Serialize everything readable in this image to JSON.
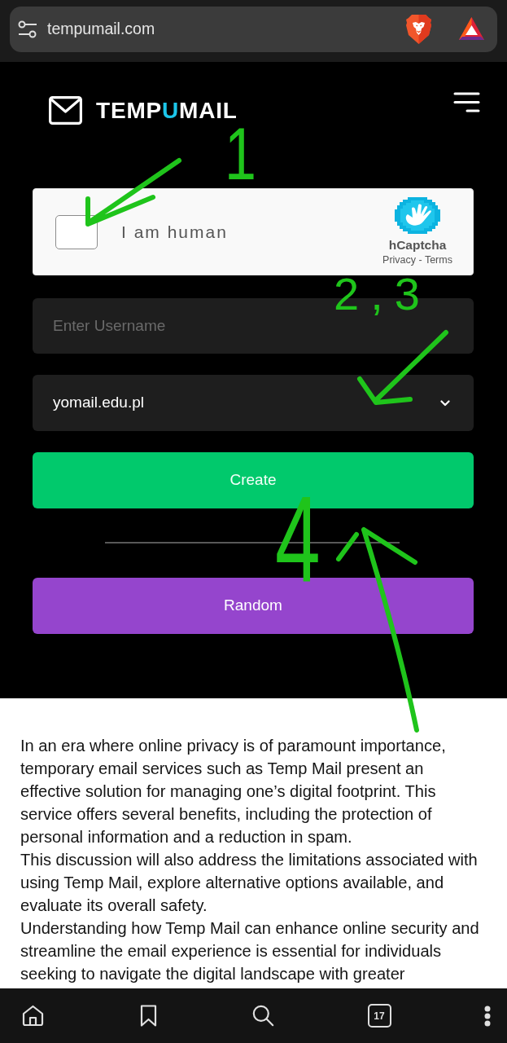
{
  "browser": {
    "url": "tempumail.com",
    "tab_count": "17"
  },
  "header": {
    "logo": [
      {
        "text": "TEMP",
        "accent": false
      },
      {
        "text": "U",
        "accent": true
      },
      {
        "text": "MAIL",
        "accent": false
      }
    ]
  },
  "captcha": {
    "checked": false,
    "label": "I am human",
    "brand": "hCaptcha",
    "links": "Privacy - Terms"
  },
  "form": {
    "username": {
      "placeholder": "Enter Username"
    },
    "domain": {
      "value": "yomail.edu.pl"
    },
    "buttons": [
      {
        "label": "Create",
        "kind": "primary"
      },
      {
        "label": "Random",
        "kind": "secondary"
      }
    ]
  },
  "article": {
    "paragraphs": [
      "In an era where online privacy is of paramount importance, temporary email services such as Temp Mail present an effective solution for managing one’s digital footprint. This service offers several benefits, including the protection of personal information and a reduction in spam.",
      "This discussion will also address the limitations associated with using Temp Mail, explore alternative options available, and evaluate its overall safety.",
      "Understanding how Temp Mail can enhance online security and streamline the email experience is essential for individuals seeking to navigate the digital landscape with greater"
    ]
  },
  "annotations": [
    {
      "kind": "number",
      "text": "1"
    },
    {
      "kind": "arrow"
    },
    {
      "kind": "number",
      "text": "2,3"
    },
    {
      "kind": "arrow"
    },
    {
      "kind": "number",
      "text": "4"
    },
    {
      "kind": "arrow"
    }
  ]
}
